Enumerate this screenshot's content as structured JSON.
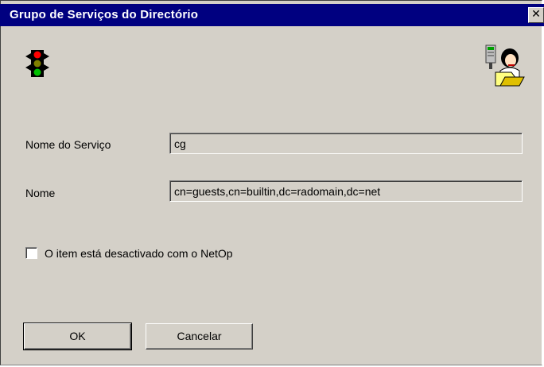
{
  "window": {
    "title": "Grupo de Serviços do Directório",
    "close_glyph": "✕"
  },
  "icons": {
    "traffic_light": "traffic-light-icon",
    "user_directory": "user-directory-icon"
  },
  "form": {
    "service_name_label": "Nome do Serviço",
    "service_name_value": "cg",
    "name_label": "Nome",
    "name_value": "cn=guests,cn=builtin,dc=radomain,dc=net",
    "disabled_checkbox_label": "O item está desactivado com o NetOp",
    "disabled_checked": false
  },
  "buttons": {
    "ok_label": "OK",
    "cancel_label": "Cancelar"
  },
  "colors": {
    "titlebar": "#000080",
    "dialog_bg": "#d4d0c8"
  }
}
